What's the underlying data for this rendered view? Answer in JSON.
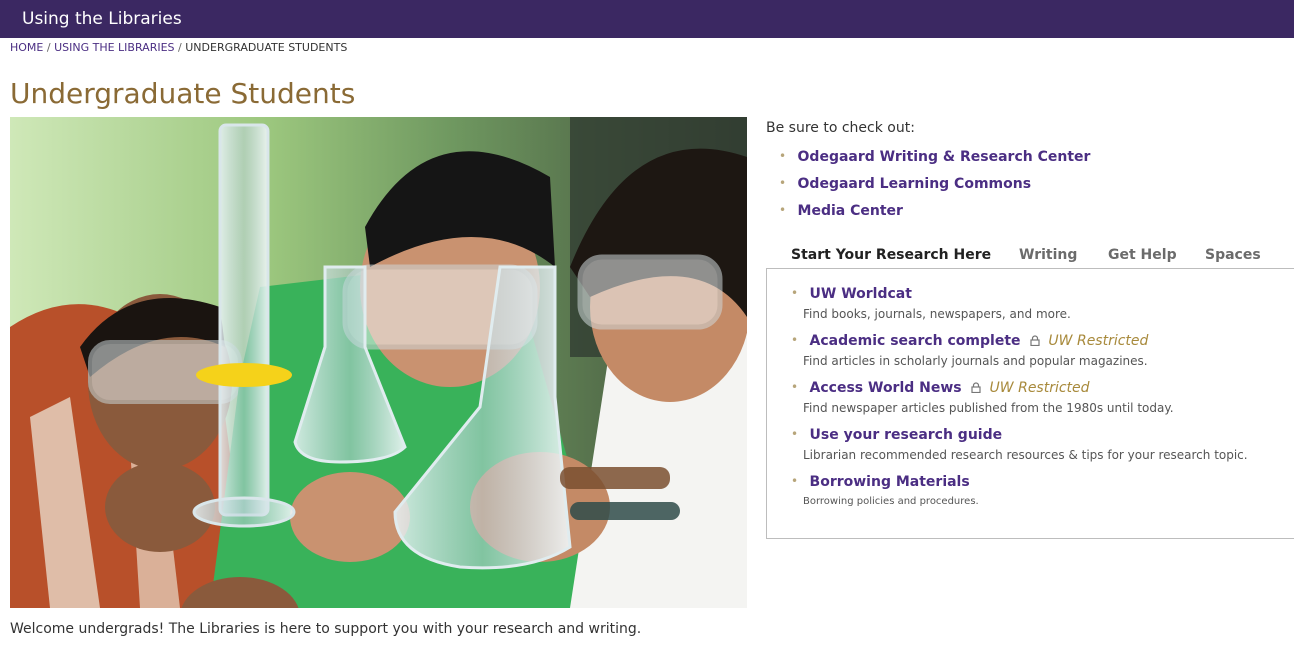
{
  "header": {
    "title": "Using the Libraries"
  },
  "breadcrumb": {
    "home": "HOME",
    "section": "USING THE LIBRARIES",
    "current": "UNDERGRADUATE STUDENTS",
    "separator": "/"
  },
  "page": {
    "title": "Undergraduate Students",
    "welcome": "Welcome undergrads! The Libraries is here to support you with your research and writing."
  },
  "checkout": {
    "intro": "Be sure to check out:",
    "bullet": "•",
    "links": [
      "Odegaard Writing & Research Center",
      "Odegaard Learning Commons",
      "Media Center"
    ]
  },
  "tabs": [
    "Start Your Research Here",
    "Writing",
    "Get Help",
    "Spaces"
  ],
  "active_tab": "Start Your Research Here",
  "resources": [
    {
      "title": "UW Worldcat",
      "desc": "Find books, journals, newspapers, and more."
    },
    {
      "title": "Academic search complete",
      "restricted": "UW Restricted",
      "desc": "Find articles in scholarly journals and popular magazines."
    },
    {
      "title": "Access World News",
      "restricted": "UW Restricted",
      "desc": "Find newspaper articles published from the 1980s until today."
    },
    {
      "title": "Use your research guide",
      "desc": "Librarian recommended research resources & tips for your research topic."
    },
    {
      "title": "Borrowing Materials",
      "desc": "Borrowing policies and procedures."
    }
  ],
  "icons": {
    "restricted": "lock-icon",
    "bullet": "bullet-icon"
  },
  "colors": {
    "header_bg": "#3b2862",
    "link": "#4b2e83",
    "title_gold": "#8a6a35",
    "restricted_gold": "#a88a3c",
    "bullet_gold": "#b7a57a"
  }
}
